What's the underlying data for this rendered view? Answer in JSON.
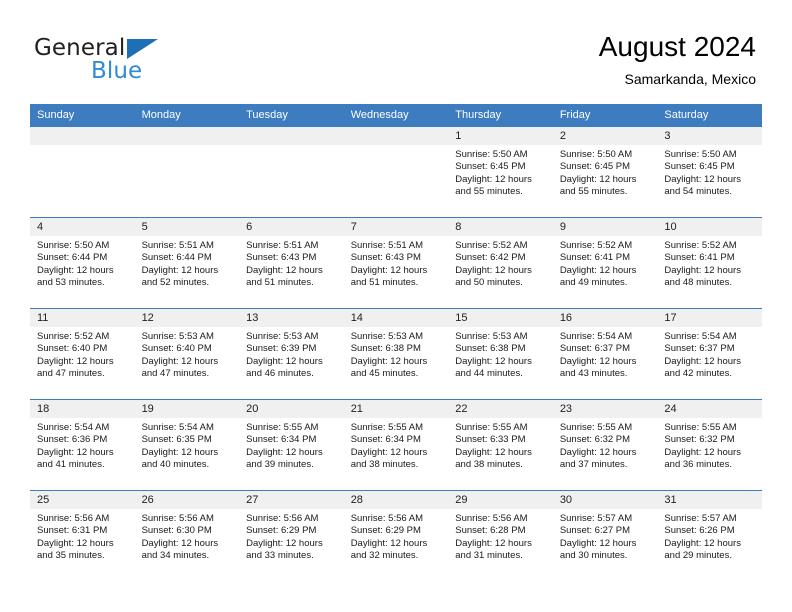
{
  "brand": {
    "line1": "General",
    "line2": "Blue",
    "triangle_icon": "triangle-logo-icon",
    "color_dark": "#231f20",
    "color_blue": "#2e8bd4"
  },
  "header": {
    "title": "August 2024",
    "subtitle": "Samarkanda, Mexico"
  },
  "theme": {
    "header_bg": "#3c7cbf",
    "daynum_bg": "#f0f0f0",
    "grid_line": "#3c7cbf"
  },
  "weekdays": [
    "Sunday",
    "Monday",
    "Tuesday",
    "Wednesday",
    "Thursday",
    "Friday",
    "Saturday"
  ],
  "weeks": [
    [
      {
        "day": "",
        "blank": true,
        "sunrise": "",
        "sunset": "",
        "daylight_l1": "",
        "daylight_l2": ""
      },
      {
        "day": "",
        "blank": true,
        "sunrise": "",
        "sunset": "",
        "daylight_l1": "",
        "daylight_l2": ""
      },
      {
        "day": "",
        "blank": true,
        "sunrise": "",
        "sunset": "",
        "daylight_l1": "",
        "daylight_l2": ""
      },
      {
        "day": "",
        "blank": true,
        "sunrise": "",
        "sunset": "",
        "daylight_l1": "",
        "daylight_l2": ""
      },
      {
        "day": "1",
        "blank": false,
        "sunrise": "Sunrise: 5:50 AM",
        "sunset": "Sunset: 6:45 PM",
        "daylight_l1": "Daylight: 12 hours",
        "daylight_l2": "and 55 minutes."
      },
      {
        "day": "2",
        "blank": false,
        "sunrise": "Sunrise: 5:50 AM",
        "sunset": "Sunset: 6:45 PM",
        "daylight_l1": "Daylight: 12 hours",
        "daylight_l2": "and 55 minutes."
      },
      {
        "day": "3",
        "blank": false,
        "sunrise": "Sunrise: 5:50 AM",
        "sunset": "Sunset: 6:45 PM",
        "daylight_l1": "Daylight: 12 hours",
        "daylight_l2": "and 54 minutes."
      }
    ],
    [
      {
        "day": "4",
        "blank": false,
        "sunrise": "Sunrise: 5:50 AM",
        "sunset": "Sunset: 6:44 PM",
        "daylight_l1": "Daylight: 12 hours",
        "daylight_l2": "and 53 minutes."
      },
      {
        "day": "5",
        "blank": false,
        "sunrise": "Sunrise: 5:51 AM",
        "sunset": "Sunset: 6:44 PM",
        "daylight_l1": "Daylight: 12 hours",
        "daylight_l2": "and 52 minutes."
      },
      {
        "day": "6",
        "blank": false,
        "sunrise": "Sunrise: 5:51 AM",
        "sunset": "Sunset: 6:43 PM",
        "daylight_l1": "Daylight: 12 hours",
        "daylight_l2": "and 51 minutes."
      },
      {
        "day": "7",
        "blank": false,
        "sunrise": "Sunrise: 5:51 AM",
        "sunset": "Sunset: 6:43 PM",
        "daylight_l1": "Daylight: 12 hours",
        "daylight_l2": "and 51 minutes."
      },
      {
        "day": "8",
        "blank": false,
        "sunrise": "Sunrise: 5:52 AM",
        "sunset": "Sunset: 6:42 PM",
        "daylight_l1": "Daylight: 12 hours",
        "daylight_l2": "and 50 minutes."
      },
      {
        "day": "9",
        "blank": false,
        "sunrise": "Sunrise: 5:52 AM",
        "sunset": "Sunset: 6:41 PM",
        "daylight_l1": "Daylight: 12 hours",
        "daylight_l2": "and 49 minutes."
      },
      {
        "day": "10",
        "blank": false,
        "sunrise": "Sunrise: 5:52 AM",
        "sunset": "Sunset: 6:41 PM",
        "daylight_l1": "Daylight: 12 hours",
        "daylight_l2": "and 48 minutes."
      }
    ],
    [
      {
        "day": "11",
        "blank": false,
        "sunrise": "Sunrise: 5:52 AM",
        "sunset": "Sunset: 6:40 PM",
        "daylight_l1": "Daylight: 12 hours",
        "daylight_l2": "and 47 minutes."
      },
      {
        "day": "12",
        "blank": false,
        "sunrise": "Sunrise: 5:53 AM",
        "sunset": "Sunset: 6:40 PM",
        "daylight_l1": "Daylight: 12 hours",
        "daylight_l2": "and 47 minutes."
      },
      {
        "day": "13",
        "blank": false,
        "sunrise": "Sunrise: 5:53 AM",
        "sunset": "Sunset: 6:39 PM",
        "daylight_l1": "Daylight: 12 hours",
        "daylight_l2": "and 46 minutes."
      },
      {
        "day": "14",
        "blank": false,
        "sunrise": "Sunrise: 5:53 AM",
        "sunset": "Sunset: 6:38 PM",
        "daylight_l1": "Daylight: 12 hours",
        "daylight_l2": "and 45 minutes."
      },
      {
        "day": "15",
        "blank": false,
        "sunrise": "Sunrise: 5:53 AM",
        "sunset": "Sunset: 6:38 PM",
        "daylight_l1": "Daylight: 12 hours",
        "daylight_l2": "and 44 minutes."
      },
      {
        "day": "16",
        "blank": false,
        "sunrise": "Sunrise: 5:54 AM",
        "sunset": "Sunset: 6:37 PM",
        "daylight_l1": "Daylight: 12 hours",
        "daylight_l2": "and 43 minutes."
      },
      {
        "day": "17",
        "blank": false,
        "sunrise": "Sunrise: 5:54 AM",
        "sunset": "Sunset: 6:37 PM",
        "daylight_l1": "Daylight: 12 hours",
        "daylight_l2": "and 42 minutes."
      }
    ],
    [
      {
        "day": "18",
        "blank": false,
        "sunrise": "Sunrise: 5:54 AM",
        "sunset": "Sunset: 6:36 PM",
        "daylight_l1": "Daylight: 12 hours",
        "daylight_l2": "and 41 minutes."
      },
      {
        "day": "19",
        "blank": false,
        "sunrise": "Sunrise: 5:54 AM",
        "sunset": "Sunset: 6:35 PM",
        "daylight_l1": "Daylight: 12 hours",
        "daylight_l2": "and 40 minutes."
      },
      {
        "day": "20",
        "blank": false,
        "sunrise": "Sunrise: 5:55 AM",
        "sunset": "Sunset: 6:34 PM",
        "daylight_l1": "Daylight: 12 hours",
        "daylight_l2": "and 39 minutes."
      },
      {
        "day": "21",
        "blank": false,
        "sunrise": "Sunrise: 5:55 AM",
        "sunset": "Sunset: 6:34 PM",
        "daylight_l1": "Daylight: 12 hours",
        "daylight_l2": "and 38 minutes."
      },
      {
        "day": "22",
        "blank": false,
        "sunrise": "Sunrise: 5:55 AM",
        "sunset": "Sunset: 6:33 PM",
        "daylight_l1": "Daylight: 12 hours",
        "daylight_l2": "and 38 minutes."
      },
      {
        "day": "23",
        "blank": false,
        "sunrise": "Sunrise: 5:55 AM",
        "sunset": "Sunset: 6:32 PM",
        "daylight_l1": "Daylight: 12 hours",
        "daylight_l2": "and 37 minutes."
      },
      {
        "day": "24",
        "blank": false,
        "sunrise": "Sunrise: 5:55 AM",
        "sunset": "Sunset: 6:32 PM",
        "daylight_l1": "Daylight: 12 hours",
        "daylight_l2": "and 36 minutes."
      }
    ],
    [
      {
        "day": "25",
        "blank": false,
        "sunrise": "Sunrise: 5:56 AM",
        "sunset": "Sunset: 6:31 PM",
        "daylight_l1": "Daylight: 12 hours",
        "daylight_l2": "and 35 minutes."
      },
      {
        "day": "26",
        "blank": false,
        "sunrise": "Sunrise: 5:56 AM",
        "sunset": "Sunset: 6:30 PM",
        "daylight_l1": "Daylight: 12 hours",
        "daylight_l2": "and 34 minutes."
      },
      {
        "day": "27",
        "blank": false,
        "sunrise": "Sunrise: 5:56 AM",
        "sunset": "Sunset: 6:29 PM",
        "daylight_l1": "Daylight: 12 hours",
        "daylight_l2": "and 33 minutes."
      },
      {
        "day": "28",
        "blank": false,
        "sunrise": "Sunrise: 5:56 AM",
        "sunset": "Sunset: 6:29 PM",
        "daylight_l1": "Daylight: 12 hours",
        "daylight_l2": "and 32 minutes."
      },
      {
        "day": "29",
        "blank": false,
        "sunrise": "Sunrise: 5:56 AM",
        "sunset": "Sunset: 6:28 PM",
        "daylight_l1": "Daylight: 12 hours",
        "daylight_l2": "and 31 minutes."
      },
      {
        "day": "30",
        "blank": false,
        "sunrise": "Sunrise: 5:57 AM",
        "sunset": "Sunset: 6:27 PM",
        "daylight_l1": "Daylight: 12 hours",
        "daylight_l2": "and 30 minutes."
      },
      {
        "day": "31",
        "blank": false,
        "sunrise": "Sunrise: 5:57 AM",
        "sunset": "Sunset: 6:26 PM",
        "daylight_l1": "Daylight: 12 hours",
        "daylight_l2": "and 29 minutes."
      }
    ]
  ]
}
